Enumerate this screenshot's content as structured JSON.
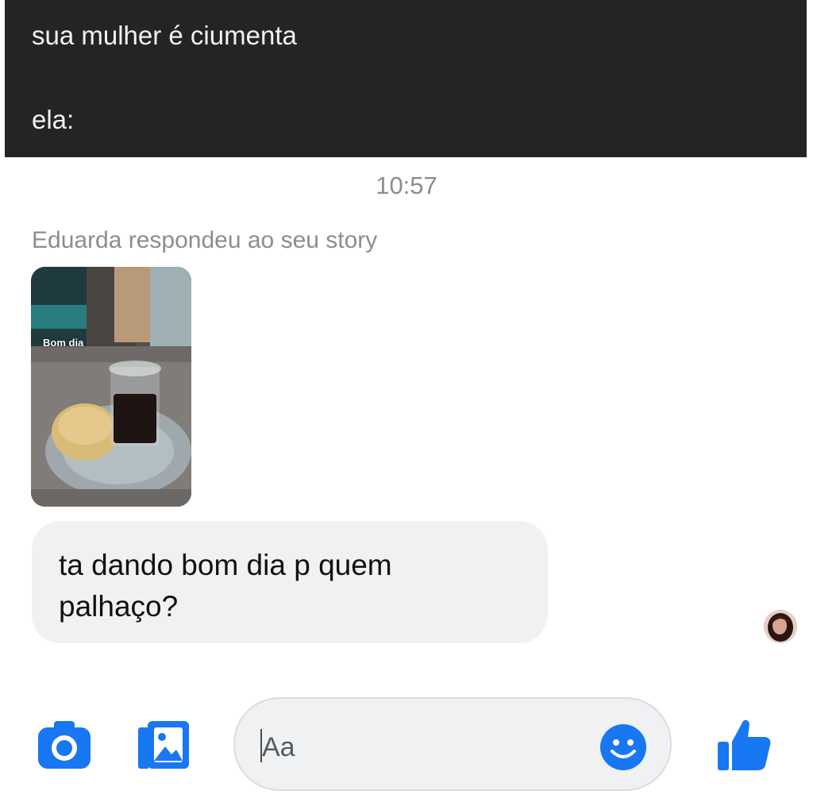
{
  "caption": {
    "line1": "sua mulher é ciumenta",
    "line2": "ela:"
  },
  "chat": {
    "timestamp": "10:57",
    "reply_note": "Eduarda respondeu ao seu story",
    "story_caption": "Bom dia",
    "message": "ta dando bom dia p quem palhaço?"
  },
  "composer": {
    "placeholder": "Aa",
    "icons": [
      "camera-icon",
      "gallery-icon",
      "emoji-icon",
      "thumbs-up-icon"
    ],
    "accent_color": "#1877f2"
  }
}
